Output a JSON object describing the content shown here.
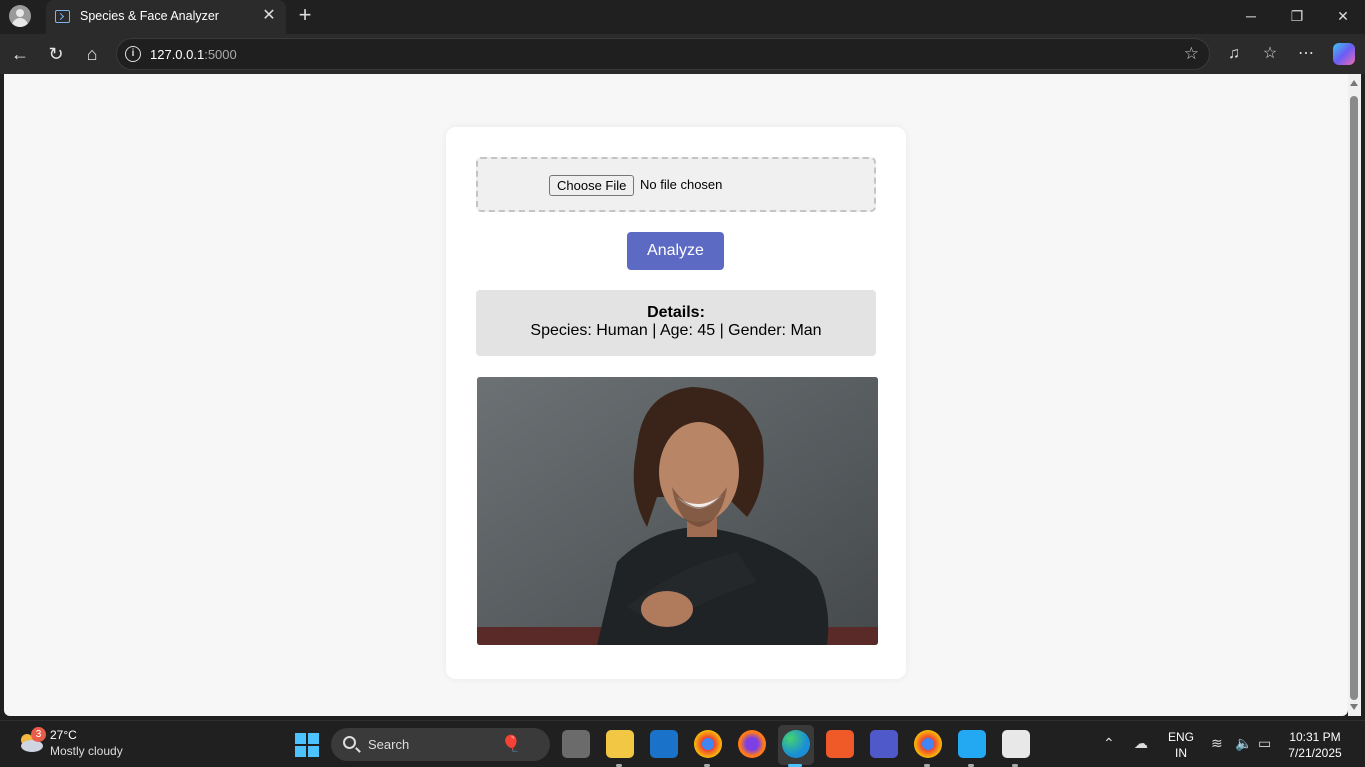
{
  "browser": {
    "tab_title": "Species & Face Analyzer",
    "url_host": "127.0.0.1",
    "url_port": ":5000"
  },
  "app": {
    "choose_file_label": "Choose File",
    "file_status": "No file chosen",
    "analyze_label": "Analyze",
    "details_label": "Details:",
    "details_text": "Species: Human | Age: 45 | Gender: Man",
    "accent_color": "#5c6ac4"
  },
  "taskbar": {
    "weather_badge": "3",
    "weather_temp": "27°C",
    "weather_condition": "Mostly cloudy",
    "search_label": "Search",
    "language_line1": "ENG",
    "language_line2": "IN",
    "time": "10:31 PM",
    "date": "7/21/2025",
    "apps": [
      "task-view",
      "file-explorer",
      "outlook",
      "chrome-profile-k",
      "firefox",
      "edge",
      "brave",
      "teams",
      "chrome",
      "vscode",
      "snipping-tool"
    ]
  }
}
